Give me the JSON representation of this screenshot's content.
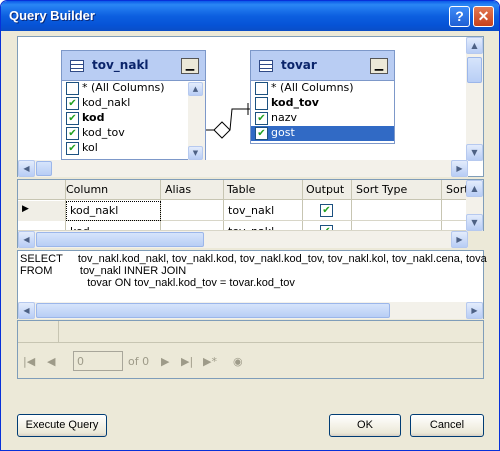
{
  "window": {
    "title": "Query Builder",
    "help": "?",
    "close": "✕"
  },
  "diagram": {
    "tables": [
      {
        "name": "tov_nakl",
        "rows": [
          {
            "label": "* (All Columns)",
            "checked": false,
            "bold": false
          },
          {
            "label": "kod_nakl",
            "checked": true,
            "bold": false
          },
          {
            "label": "kod",
            "checked": true,
            "bold": true
          },
          {
            "label": "kod_tov",
            "checked": true,
            "bold": false
          },
          {
            "label": "kol",
            "checked": true,
            "bold": false
          }
        ]
      },
      {
        "name": "tovar",
        "rows": [
          {
            "label": "* (All Columns)",
            "checked": false,
            "bold": false
          },
          {
            "label": "kod_tov",
            "checked": false,
            "bold": true
          },
          {
            "label": "nazv",
            "checked": true,
            "bold": false
          },
          {
            "label": "gost",
            "checked": true,
            "bold": false
          }
        ]
      }
    ]
  },
  "grid": {
    "headers": [
      "Column",
      "Alias",
      "Table",
      "Output",
      "Sort Type",
      "Sort"
    ],
    "rows": [
      {
        "column": "kod_nakl",
        "alias": "",
        "table": "tov_nakl",
        "output": true
      },
      {
        "column": "kod",
        "alias": "",
        "table": "tov_nakl",
        "output": true
      }
    ]
  },
  "sql": {
    "line1": "SELECT     tov_nakl.kod_nakl, tov_nakl.kod, tov_nakl.kod_tov, tov_nakl.kol, tov_nakl.cena, tova",
    "line2": "FROM         tov_nakl INNER JOIN",
    "line3": "                      tovar ON tov_nakl.kod_tov = tovar.kod_tov"
  },
  "nav": {
    "position": "0",
    "of_label": "of 0"
  },
  "buttons": {
    "execute": "Execute Query",
    "ok": "OK",
    "cancel": "Cancel"
  }
}
